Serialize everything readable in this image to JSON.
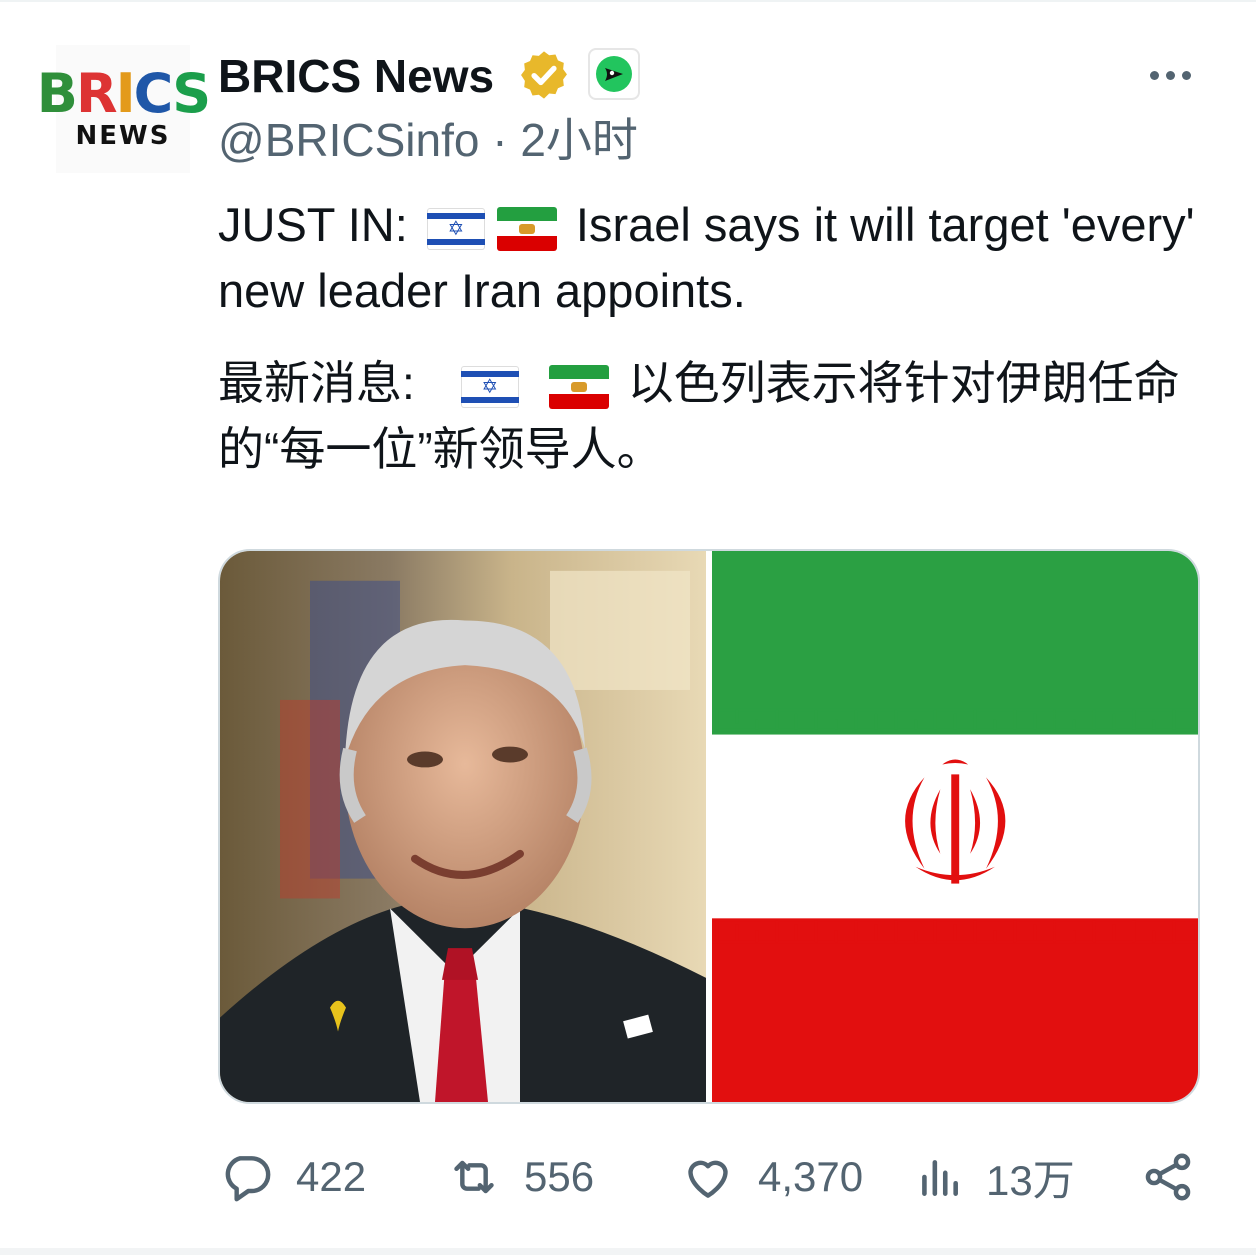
{
  "account": {
    "name": "BRICS News",
    "handle_line": "@BRICSinfo · 2小时",
    "avatar_logo_letters": [
      "B",
      "R",
      "I",
      "C",
      "S"
    ],
    "avatar_logo_subtitle": "NEWS"
  },
  "tweet": {
    "en_prefix": "JUST IN:",
    "en_text": "Israel says it will target 'every' new leader Iran appoints.",
    "zh_prefix": "最新消息:",
    "zh_text": "以色列表示将针对伊朗任命的“每一位”新领导人。"
  },
  "actions": {
    "replies": "422",
    "reposts": "556",
    "likes": "4,370",
    "views": "13万"
  },
  "icons": [
    "verified-badge-icon",
    "affiliate-badge-icon",
    "more-icon",
    "reply-icon",
    "repost-icon",
    "like-icon",
    "views-icon",
    "share-icon"
  ],
  "colors": {
    "text": "#0f1419",
    "secondary": "#536471",
    "verified_gold": "#e8b82b",
    "iran_green": "#239f40",
    "iran_red": "#da0000",
    "israel_blue": "#1e4fb4"
  }
}
